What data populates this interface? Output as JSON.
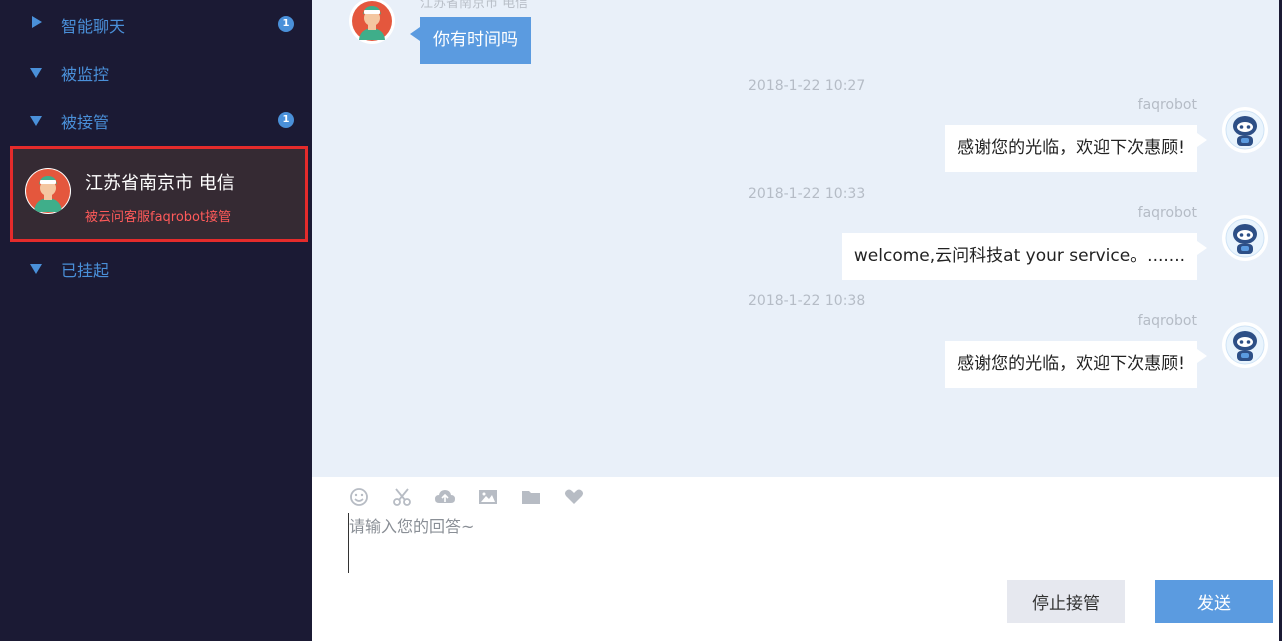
{
  "sidebar": {
    "sections": [
      {
        "label": "智能聊天",
        "badge": "1",
        "expanded": false
      },
      {
        "label": "被监控",
        "badge": "",
        "expanded": true
      },
      {
        "label": "被接管",
        "badge": "1",
        "expanded": true
      },
      {
        "label": "已挂起",
        "badge": "",
        "expanded": true
      }
    ],
    "active_conversation": {
      "name": "江苏省南京市 电信",
      "status": "被云问客服faqrobot接管"
    }
  },
  "chat": {
    "messages": [
      {
        "type": "user",
        "sender": "江苏省南京市 电信",
        "text": "你有时间吗"
      },
      {
        "type": "bot",
        "timestamp": "2018-1-22 10:27",
        "sender": "faqrobot",
        "text": "感谢您的光临，欢迎下次惠顾!"
      },
      {
        "type": "bot",
        "timestamp": "2018-1-22 10:33",
        "sender": "faqrobot",
        "text": "welcome,云问科技at your service。......."
      },
      {
        "type": "bot",
        "timestamp": "2018-1-22 10:38",
        "sender": "faqrobot",
        "text": "感谢您的光临，欢迎下次惠顾!"
      }
    ]
  },
  "composer": {
    "toolbar_icons": [
      "emoji-icon",
      "scissors-icon",
      "cloud-upload-icon",
      "image-icon",
      "folder-icon",
      "heart-icon"
    ],
    "placeholder": "请输入您的回答~",
    "stop_label": "停止接管",
    "send_label": "发送"
  },
  "colors": {
    "sidebar_bg": "#1b1a34",
    "accent": "#5b9be0",
    "highlight_border": "#e42b2b",
    "chat_bg": "#e9f0f9"
  }
}
